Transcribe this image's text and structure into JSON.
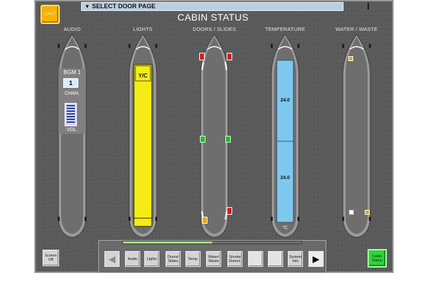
{
  "header": {
    "caution_label": "CAUT",
    "select_page_label": "SELECT DOOR PAGE",
    "title": "CABIN STATUS"
  },
  "columns": [
    {
      "id": "audio",
      "label": "AUDIO"
    },
    {
      "id": "lights",
      "label": "LIGHTS"
    },
    {
      "id": "doors",
      "label": "DOORS / SLIDES"
    },
    {
      "id": "temperature",
      "label": "TEMPERATURE"
    },
    {
      "id": "water",
      "label": "WATER / WASTE"
    }
  ],
  "audio": {
    "channel_label": "BGM 1",
    "channel_value": "1",
    "chan_label": "CHAN.",
    "vol_label": "VOL."
  },
  "lights": {
    "zone_label": "Y/C",
    "color": "#f4ec14"
  },
  "doors": {
    "closed_color": "#2fb52f",
    "armed_color": "#d41c1c",
    "caution_color": "#f0a500"
  },
  "temperature": {
    "fwd_value": "24.0",
    "aft_value": "24.0",
    "unit": "°C",
    "zone_color": "#7ec8ef"
  },
  "water": {
    "indicator_color": "#e8a800"
  },
  "nav": {
    "progress": 0.5,
    "buttons": [
      {
        "id": "audio",
        "label": "Audio"
      },
      {
        "id": "lights",
        "label": "Lights"
      },
      {
        "id": "doors",
        "label": "Doors/ Slides"
      },
      {
        "id": "temp",
        "label": "Temp."
      },
      {
        "id": "water",
        "label": "Water/ Waste"
      },
      {
        "id": "smoke",
        "label": "Smoke Detect."
      },
      {
        "id": "blank1",
        "label": ""
      },
      {
        "id": "blank2",
        "label": ""
      },
      {
        "id": "sysinfo",
        "label": "System Info"
      }
    ],
    "screen_off_label": "Screen Off",
    "cabin_status_label": "Cabin Status",
    "prev_icon": "left-arrow-icon",
    "next_icon": "right-arrow-icon"
  }
}
